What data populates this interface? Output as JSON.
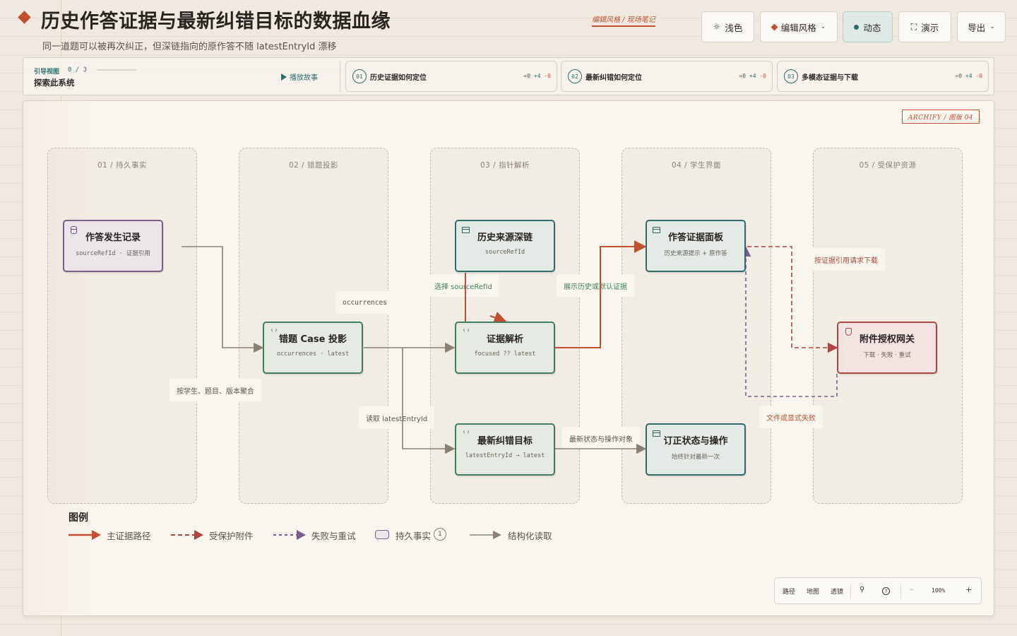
{
  "header": {
    "title": "历史作答证据与最新纠错目标的数据血缘",
    "subtitle": "同一道题可以被再次纠正，但深链指向的原作答不随 latestEntryId 漂移",
    "style_tag": "编辑风格 / 现场笔记",
    "toolbar": {
      "theme_label": "浅色",
      "style_label": "编辑风格",
      "motion_label": "动态",
      "present_label": "演示",
      "export_label": "导出"
    }
  },
  "guide": {
    "label": "引导视图",
    "count": "0 / 3",
    "progress": 0,
    "explore": "探索此系统",
    "play": "播放故事",
    "steps": [
      {
        "num": "01",
        "label": "历史证据如何定位",
        "diff_eq": "=0",
        "diff_add": "+4",
        "diff_rem": "-0"
      },
      {
        "num": "02",
        "label": "最新纠错如何定位",
        "diff_eq": "=0",
        "diff_add": "+4",
        "diff_rem": "-0"
      },
      {
        "num": "03",
        "label": "多模态证据与下载",
        "diff_eq": "=0",
        "diff_add": "+4",
        "diff_rem": "-0"
      }
    ]
  },
  "stamp": "ARCHIFY / 图版 04",
  "lanes": [
    "01 / 持久事实",
    "02 / 错题投影",
    "03 / 指针解析",
    "04 / 学生界面",
    "05 / 受保护资源"
  ],
  "nodes": {
    "attempt_record": {
      "title": "作答发生记录",
      "sub": "sourceRefId · 证据引用"
    },
    "wrong_case": {
      "title": "错题 Case 投影",
      "sub": "occurrences · latest"
    },
    "history_link": {
      "title": "历史来源深链",
      "sub": "sourceRefId"
    },
    "evidence_resolve": {
      "title": "证据解析",
      "sub": "focused ?? latest"
    },
    "latest_target": {
      "title": "最新纠错目标",
      "sub": "latestEntryId → latest"
    },
    "evidence_panel": {
      "title": "作答证据面板",
      "sub": "历史来源提示 + 原作答"
    },
    "revision_status": {
      "title": "订正状态与操作",
      "sub": "始终针对最新一次"
    },
    "attachment_gateway": {
      "title": "附件授权网关",
      "sub": "下载 · 失败 · 重试"
    }
  },
  "edge_labels": {
    "occurrences": "occurrences",
    "aggregate": "按学生、题目、版本聚合",
    "select_source": "选择 sourceRefId",
    "show_evidence": "展示历史或默认证据",
    "read_latest": "读取 latestEntryId",
    "latest_state": "最新状态与操作对象",
    "request_download": "按证据引用请求下载",
    "explicit_fail": "文件或显式失败"
  },
  "legend": {
    "title": "图例",
    "items": [
      "主证据路径",
      "受保护附件",
      "失败与重试",
      "持久事实",
      "结构化读取"
    ],
    "badge": "1"
  },
  "zoom": {
    "path": "路径",
    "map": "地图",
    "lens": "透镜",
    "level": "100%",
    "minus": "−",
    "plus": "+"
  },
  "colors": {
    "accent_orange": "#c2502f",
    "teal": "#2f6b6c",
    "green": "#3f7e58",
    "purple": "#7a5c8e",
    "red": "#b0443f",
    "gray_wire": "#8a7f72"
  }
}
